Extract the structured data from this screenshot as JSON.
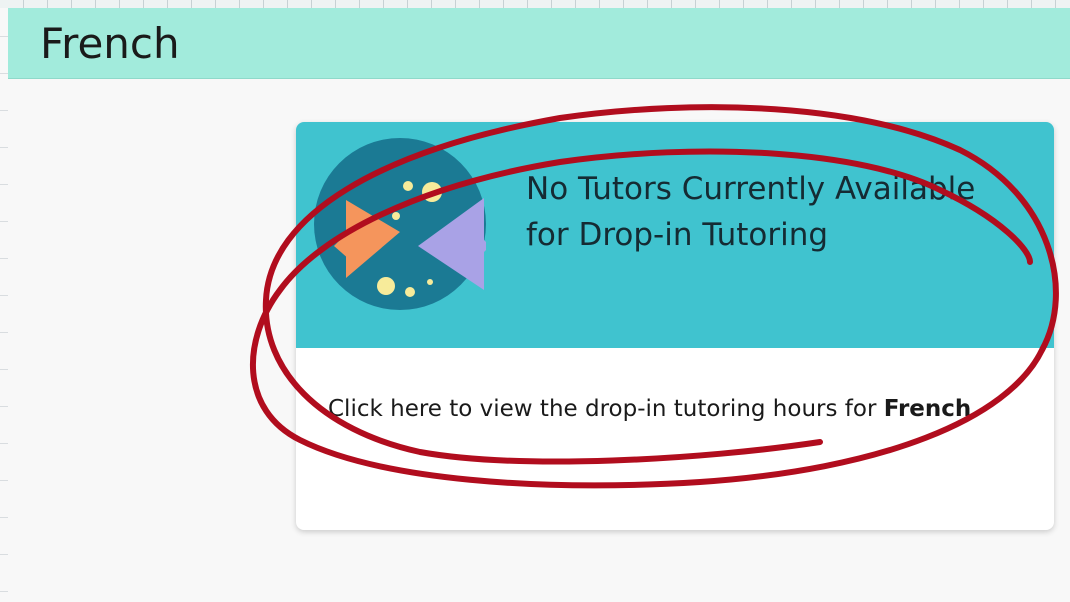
{
  "header": {
    "title": "French"
  },
  "card": {
    "title": "No Tutors Currently Available for Drop-in Tutoring",
    "body_prefix": "Click here to view the drop-in tutoring hours for ",
    "body_subject": "French",
    "logo_icon": "fish-logo-icon"
  },
  "colors": {
    "header_bg": "#a2ebdc",
    "card_head_bg": "#40c3cf",
    "logo_circle": "#1b7a94",
    "fish_orange": "#f5955c",
    "fish_purple": "#a9a2e6",
    "bubble": "#f7eb9a",
    "annotation_red": "#b10d1e"
  }
}
